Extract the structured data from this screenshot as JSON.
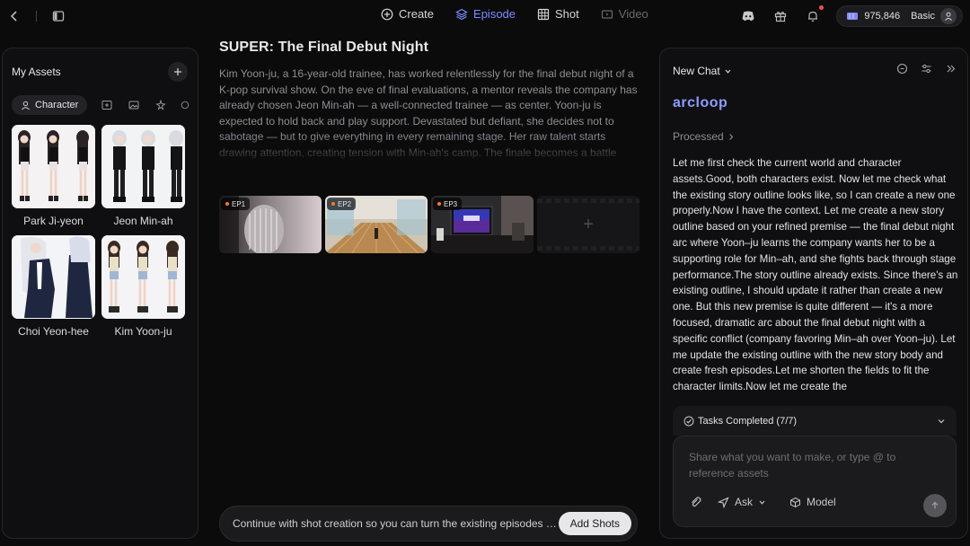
{
  "topbar": {
    "tabs": [
      {
        "label": "Create",
        "state": "normal"
      },
      {
        "label": "Episode",
        "state": "active"
      },
      {
        "label": "Shot",
        "state": "normal"
      },
      {
        "label": "Video",
        "state": "disabled"
      }
    ],
    "credits": "975,846",
    "plan": "Basic"
  },
  "assets": {
    "title": "My Assets",
    "filter_active": "Character",
    "characters": [
      {
        "name": "Park Ji-yeon"
      },
      {
        "name": "Jeon Min-ah"
      },
      {
        "name": "Choi Yeon-hee"
      },
      {
        "name": "Kim Yoon-ju"
      }
    ]
  },
  "story": {
    "title": "SUPER: The Final Debut Night",
    "body": "Kim Yoon-ju, a 16-year-old trainee, has worked relentlessly for the final debut night of a K-pop survival show. On the eve of final evaluations, a mentor reveals the company has already chosen Jeon Min-ah — a well-connected trainee — as center. Yoon-ju is expected to hold back and play support. Devastated but defiant, she decides not to sabotage — but to give everything in every remaining stage. Her raw talent starts drawing attention, creating tension with Min-ah's camp. The finale becomes a battle between what was planned and what is earned.",
    "episodes": [
      {
        "label": "EP1"
      },
      {
        "label": "EP2"
      },
      {
        "label": "EP3"
      }
    ],
    "add_symbol": "+"
  },
  "prompt_bar": {
    "suggestion": "Continue with shot creation so you can turn the existing episodes into shots.",
    "button": "Add Shots"
  },
  "chat": {
    "title": "New Chat",
    "brand": "arcloop",
    "processed": "Processed",
    "message": "Let me first check the current world and character assets.Good, both characters exist. Now let me check what the existing story outline looks like, so I can create a new one properly.Now I have the context. Let me create a new story outline based on your refined premise — the final debut night arc where Yoon–ju learns the company wants her to be a supporting role for Min–ah, and she fights back through stage performance.The story outline already exists. Since there's an existing outline, I should update it rather than create a new one. But this new premise is quite different — it's a more focused, dramatic arc about the final debut night with a specific conflict (company favoring Min–ah over Yoon–ju). Let me update the existing outline with the new story body and create fresh episodes.Let me shorten the fields to fit the character limits.Now let me create the",
    "tasks": "Tasks Completed (7/7)",
    "composer_placeholder": "Share what you want to make, or type @ to reference assets",
    "ask_label": "Ask",
    "model_label": "Model"
  },
  "colors": {
    "accent": "#7c8cff",
    "background": "#0b0b0c",
    "panel": "#0f0f11"
  }
}
